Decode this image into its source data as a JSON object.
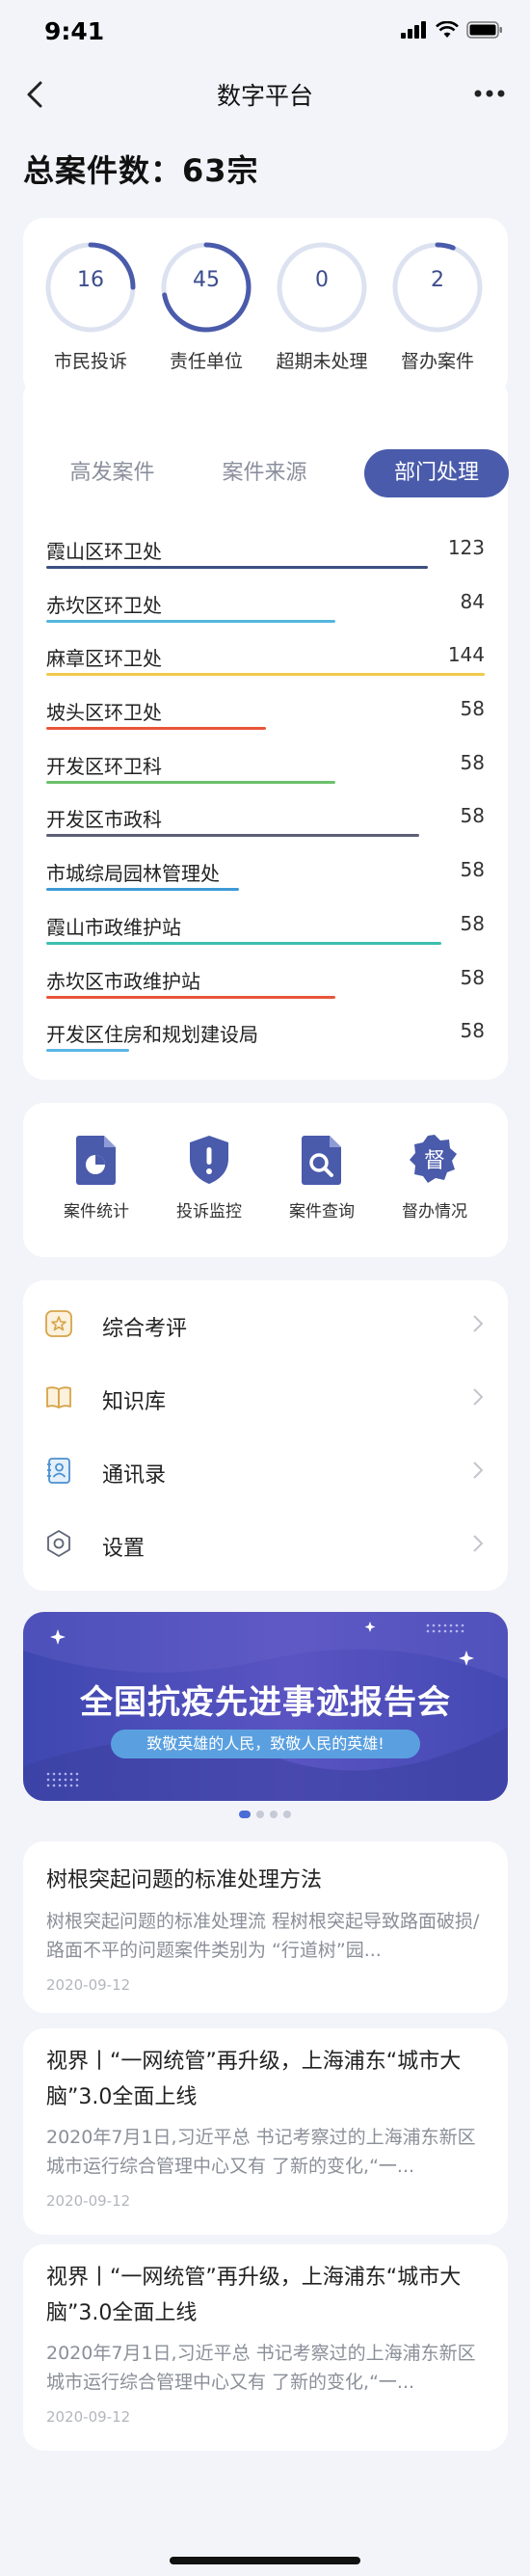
{
  "status": {
    "time": "9:41"
  },
  "nav": {
    "title": "数字平台"
  },
  "summary": {
    "total_label": "总案件数：63宗"
  },
  "circles": [
    {
      "value": "16",
      "label": "市民投诉",
      "progress": 0.25
    },
    {
      "value": "45",
      "label": "责任单位",
      "progress": 0.72
    },
    {
      "value": "0",
      "label": "超期未处理",
      "progress": 0
    },
    {
      "value": "2",
      "label": "督办案件",
      "progress": 0.06
    }
  ],
  "tabs": [
    {
      "label": "高发案件"
    },
    {
      "label": "案件来源"
    },
    {
      "label": "部门处理"
    }
  ],
  "departments": [
    {
      "name": "霞山区环卫处",
      "value": "123",
      "bar_fraction": 0.87,
      "color": "#3d4f80"
    },
    {
      "name": "赤坎区环卫处",
      "value": "84",
      "bar_fraction": 0.66,
      "color": "#55b6de"
    },
    {
      "name": "麻章区环卫处",
      "value": "144",
      "bar_fraction": 1.0,
      "color": "#f2c94c"
    },
    {
      "name": "坡头区环卫处",
      "value": "58",
      "bar_fraction": 0.5,
      "color": "#e8553a"
    },
    {
      "name": "开发区环卫科",
      "value": "58",
      "bar_fraction": 0.66,
      "color": "#6cc06c"
    },
    {
      "name": "开发区市政科",
      "value": "58",
      "bar_fraction": 0.85,
      "color": "#5c5f76"
    },
    {
      "name": "市城综局园林管理处",
      "value": "58",
      "bar_fraction": 0.44,
      "color": "#3e9ad6"
    },
    {
      "name": "霞山市政维护站",
      "value": "58",
      "bar_fraction": 0.9,
      "color": "#3dbfae"
    },
    {
      "name": "赤坎区市政维护站",
      "value": "58",
      "bar_fraction": 0.66,
      "color": "#e8553a"
    },
    {
      "name": "开发区住房和规划建设局",
      "value": "58",
      "bar_fraction": 0.19,
      "color": "#5ab5e6"
    }
  ],
  "quick_actions": [
    {
      "label": "案件统计",
      "icon": "document-chart-icon"
    },
    {
      "label": "投诉监控",
      "icon": "shield-alert-icon"
    },
    {
      "label": "案件查询",
      "icon": "document-search-icon"
    },
    {
      "label": "督办情况",
      "icon": "badge-du-icon",
      "glyph": "督"
    }
  ],
  "menu": [
    {
      "label": "综合考评",
      "icon": "star-icon"
    },
    {
      "label": "知识库",
      "icon": "book-icon"
    },
    {
      "label": "通讯录",
      "icon": "contacts-icon"
    },
    {
      "label": "设置",
      "icon": "gear-icon"
    }
  ],
  "banner": {
    "title": "全国抗疫先进事迹报告会",
    "subtitle": "致敬英雄的人民，致敬人民的英雄!"
  },
  "news": [
    {
      "title": "树根突起问题的标准处理方法",
      "desc": "树根突起问题的标准处理流 程树根突起导致路面破损/ 路面不平的问题案件类别为 “行道树”园...",
      "date": "2020-09-12"
    },
    {
      "title": "视界丨“一网统管”再升级，上海浦东“城市大脑”3.0全面上线",
      "desc": "2020年7月1日,习近平总 书记考察过的上海浦东新区 城市运行综合管理中心又有 了新的变化,“一...",
      "date": "2020-09-12"
    },
    {
      "title": "视界丨“一网统管”再升级，上海浦东“城市大脑”3.0全面上线",
      "desc": "2020年7月1日,习近平总 书记考察过的上海浦东新区 城市运行综合管理中心又有 了新的变化,“一...",
      "date": "2020-09-12"
    }
  ],
  "colors": {
    "accent": "#4a5bab",
    "circle_track": "#dde2f1",
    "circle_progress": "#4a5bab"
  }
}
